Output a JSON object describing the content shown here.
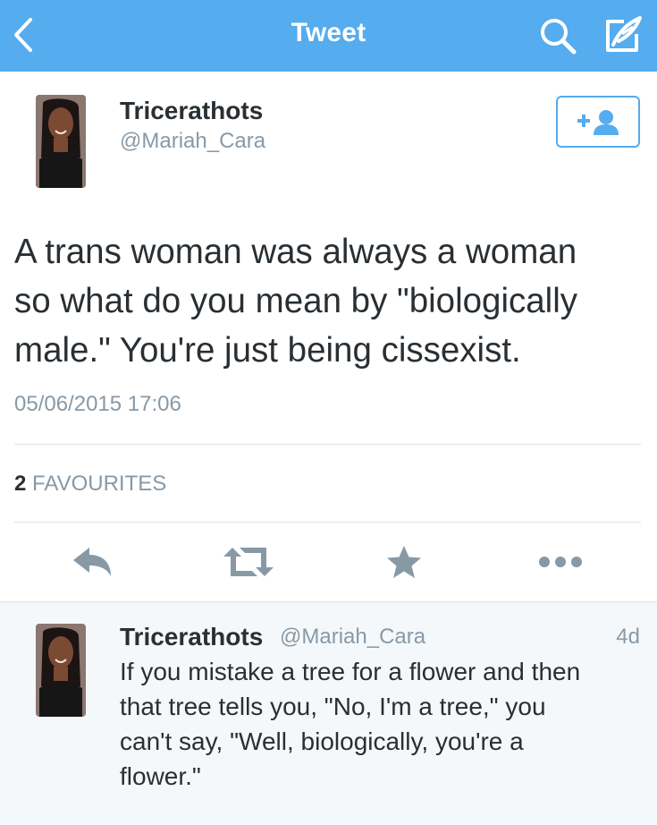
{
  "header": {
    "title": "Tweet",
    "back_icon": "chevron-left-icon",
    "search_icon": "search-icon",
    "compose_icon": "compose-icon",
    "background_color": "#55acee"
  },
  "tweet": {
    "author_name": "Tricerathots",
    "author_handle": "@Mariah_Cara",
    "follow_icon": "add-user-icon",
    "text": "A trans woman was always a woman\nso what do you mean by \"biologically\nmale.\" You're just being cissexist.",
    "timestamp": "05/06/2015 17:06",
    "favourites_count": "2",
    "favourites_label": "FAVOURITES"
  },
  "actions": [
    {
      "name": "reply-icon"
    },
    {
      "name": "retweet-icon"
    },
    {
      "name": "favorite-icon"
    },
    {
      "name": "more-icon"
    }
  ],
  "reply": {
    "author_name": "Tricerathots",
    "author_handle": "@Mariah_Cara",
    "time": "4d",
    "text": "If you mistake a tree for a flower and then\nthat tree tells you, \"No, I'm a tree,\" you\ncan't say, \"Well, biologically, you're a\nflower.\""
  },
  "colors": {
    "accent": "#55acee",
    "secondary_text": "#8899a6",
    "primary_text": "#292f33",
    "icon_gray": "#8899a6"
  }
}
